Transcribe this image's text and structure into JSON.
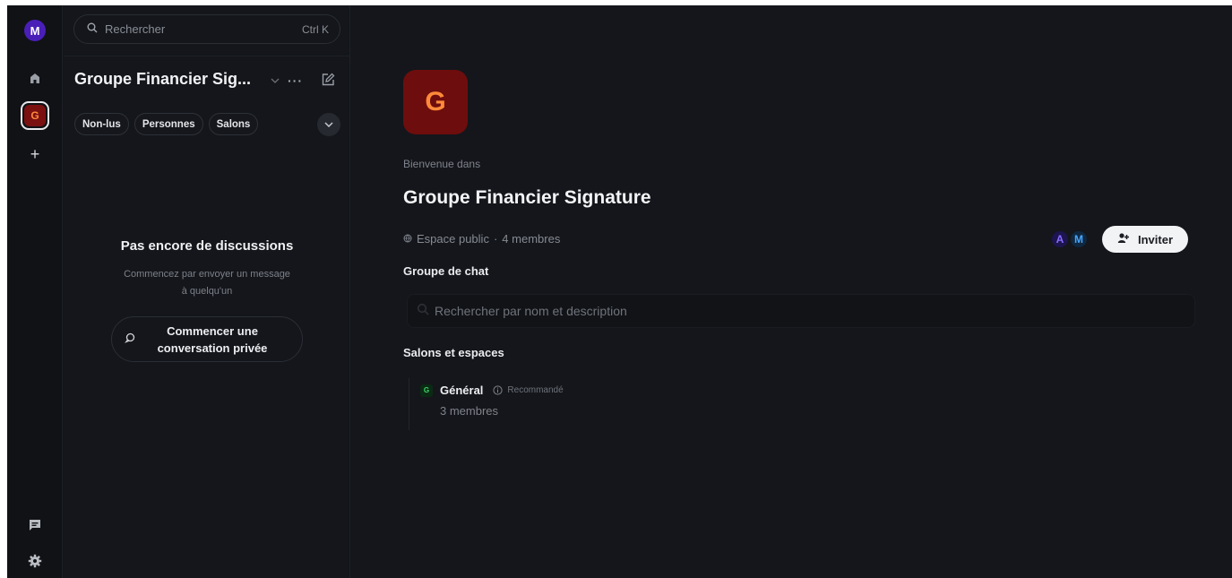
{
  "rail": {
    "user_initial": "M",
    "space_initial": "G",
    "add_label": "+"
  },
  "sidebar": {
    "search_placeholder": "Rechercher",
    "search_shortcut": "Ctrl K",
    "space_name": "Groupe Financier Sig...",
    "filters": [
      "Non-lus",
      "Personnes",
      "Salons"
    ],
    "empty_title": "Pas encore de discussions",
    "empty_subtitle_line1": "Commencez par envoyer un message",
    "empty_subtitle_line2": "à quelqu'un",
    "start_button_line1": "Commencer une",
    "start_button_line2": "conversation privée"
  },
  "main": {
    "space_initial": "G",
    "welcome": "Bienvenue dans",
    "title": "Groupe Financier Signature",
    "visibility": "Espace public",
    "separator": "·",
    "member_count": "4 membres",
    "member_avatars": [
      {
        "initial": "A",
        "color": "#8b6cff",
        "bg": "#1c1550"
      },
      {
        "initial": "M",
        "color": "#46a6ff",
        "bg": "#0f2840"
      }
    ],
    "invite_label": "Inviter",
    "chat_group_label": "Groupe de chat",
    "filter_placeholder": "Rechercher par nom et description",
    "rooms_label": "Salons et espaces",
    "rooms": [
      {
        "initial": "G",
        "name": "Général",
        "badge": "Recommandé",
        "members": "3 membres"
      }
    ]
  },
  "colors": {
    "background": "#14161b",
    "rail": "#101216",
    "space_red": "#6e0d0d",
    "space_orange": "#ff8a3a",
    "user_purple": "#4a1fb8",
    "room_green": "#3bd56b"
  }
}
